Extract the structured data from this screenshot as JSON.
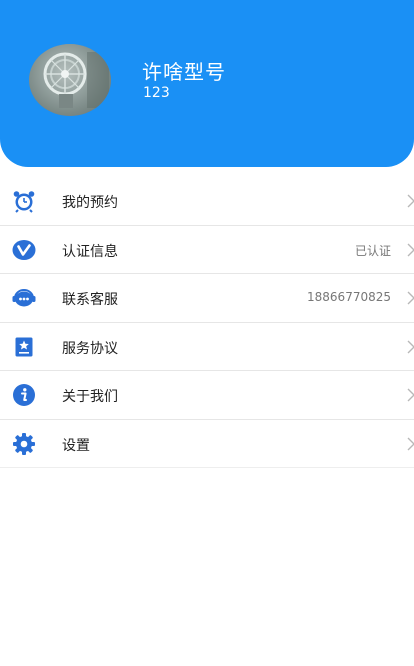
{
  "profile": {
    "name": "许啥型号",
    "id": "123"
  },
  "menu": {
    "items": [
      {
        "label": "我的预约",
        "value": "",
        "icon": "alarm-clock-icon"
      },
      {
        "label": "认证信息",
        "value": "已认证",
        "icon": "verified-v-icon"
      },
      {
        "label": "联系客服",
        "value": "18866770825",
        "icon": "customer-service-icon"
      },
      {
        "label": "服务协议",
        "value": "",
        "icon": "agreement-icon"
      },
      {
        "label": "关于我们",
        "value": "",
        "icon": "info-icon"
      },
      {
        "label": "设置",
        "value": "",
        "icon": "gear-icon"
      }
    ]
  },
  "colors": {
    "header_bg": "#1a90f5",
    "icon_blue": "#2a6fd6",
    "divider": "#e6e6e6"
  }
}
